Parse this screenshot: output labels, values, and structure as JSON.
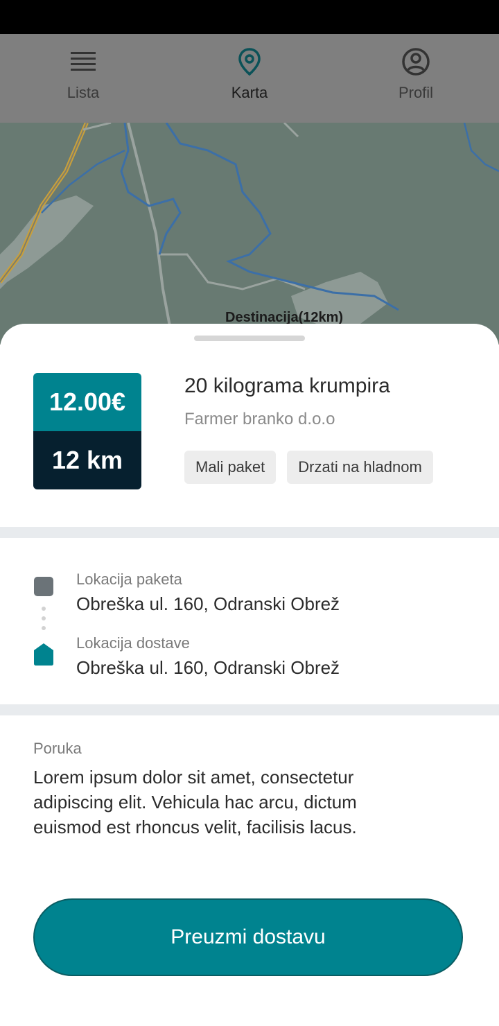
{
  "nav": {
    "items": [
      {
        "label": "Lista",
        "icon": "list-icon",
        "active": false
      },
      {
        "label": "Karta",
        "icon": "map-pin-icon",
        "active": true
      },
      {
        "label": "Profil",
        "icon": "profile-icon",
        "active": false
      }
    ]
  },
  "map": {
    "destination_label": "Destinacija(12km)"
  },
  "package": {
    "price": "12.00€",
    "distance": "12 km",
    "title": "20 kilograma krumpira",
    "sender": "Farmer branko d.o.o",
    "tags": [
      "Mali paket",
      "Drzati na hladnom"
    ]
  },
  "route": {
    "pickup_label": "Lokacija paketa",
    "pickup_address": "Obreška ul. 160, Odranski Obrež",
    "delivery_label": "Lokacija dostave",
    "delivery_address": "Obreška ul. 160, Odranski Obrež"
  },
  "message": {
    "label": "Poruka",
    "text": "Lorem ipsum dolor sit amet, consectetur adipiscing elit. Vehicula hac arcu, dictum euismod est rhoncus velit, facilisis lacus."
  },
  "cta": {
    "label": "Preuzmi dostavu"
  },
  "colors": {
    "accent": "#00838f",
    "dark": "#06202f",
    "overlay": "#7f7f7f",
    "divider": "#e8ebee"
  }
}
